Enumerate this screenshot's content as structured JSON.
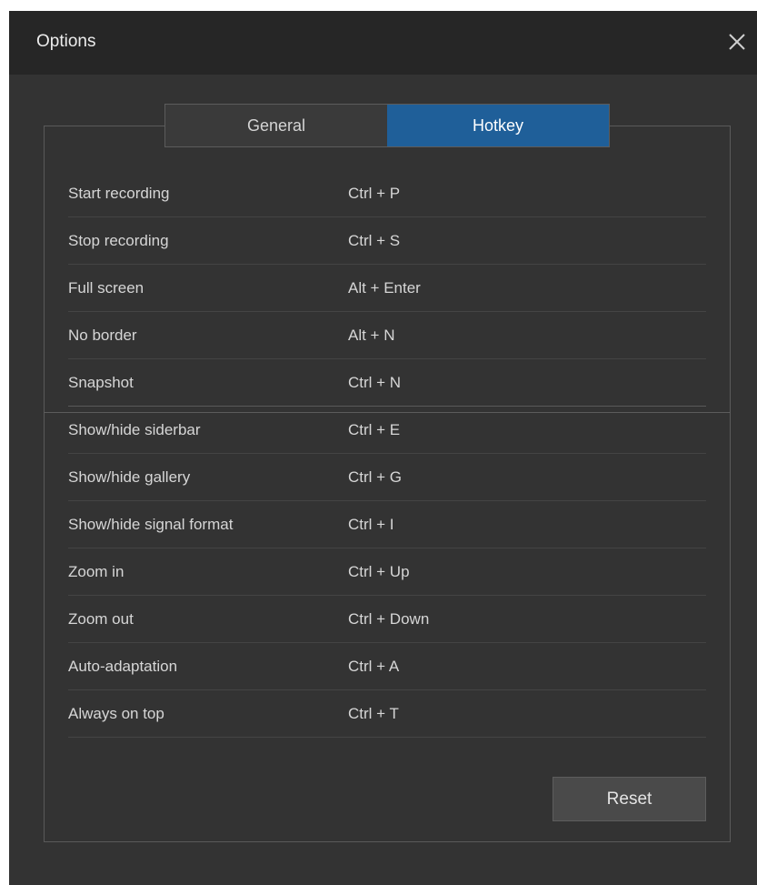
{
  "window": {
    "title": "Options"
  },
  "tabs": [
    {
      "label": "General",
      "active": false
    },
    {
      "label": "Hotkey",
      "active": true
    }
  ],
  "hotkeys": [
    {
      "action": "Start recording",
      "key": "Ctrl + P"
    },
    {
      "action": "Stop recording",
      "key": "Ctrl + S"
    },
    {
      "action": "Full screen",
      "key": "Alt + Enter"
    },
    {
      "action": "No border",
      "key": "Alt + N"
    },
    {
      "action": "Snapshot",
      "key": "Ctrl + N"
    },
    {
      "action": "Show/hide siderbar",
      "key": "Ctrl + E"
    },
    {
      "action": "Show/hide gallery",
      "key": "Ctrl + G"
    },
    {
      "action": "Show/hide signal format",
      "key": "Ctrl + I"
    },
    {
      "action": "Zoom in",
      "key": "Ctrl + Up"
    },
    {
      "action": "Zoom out",
      "key": "Ctrl + Down"
    },
    {
      "action": "Auto-adaptation",
      "key": "Ctrl + A"
    },
    {
      "action": "Always on top",
      "key": "Ctrl + T"
    }
  ],
  "buttons": {
    "reset_label": "Reset"
  },
  "icons": {
    "close": "close-icon"
  },
  "colors": {
    "accent": "#1f5f99",
    "window_bg": "#333333",
    "titlebar_bg": "#262626"
  }
}
